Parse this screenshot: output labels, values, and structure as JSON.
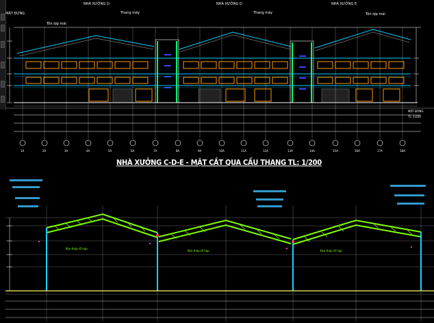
{
  "drawing": {
    "section_title": "NHÀ XƯỞNG C-D-E - MẶT CẮT QUA CẦU THANG   TL: 1/200",
    "elevation_tags": [
      "NHÀ XƯỞNG D",
      "NHÀ XƯỞNG D",
      "NHÀ XƯỞNG E"
    ],
    "top_left_tag": "MẶT ĐỨNG",
    "stair_labels": [
      "Thang máy",
      "Thang máy"
    ],
    "roof_labels": [
      "Tôn lợp mái",
      "Tôn lợp mái"
    ],
    "truss_labels": [
      "Kèo thép tổ hợp",
      "Kèo thép tổ hợp",
      "Kèo thép tổ hợp"
    ],
    "axis_labels": [
      "1A",
      "2A",
      "3A",
      "4A",
      "5A",
      "6A",
      "7A",
      "8A",
      "9A",
      "10A",
      "11A",
      "12A",
      "13A",
      "14A",
      "15A",
      "16A",
      "17A",
      "18A"
    ],
    "right_notes": [
      "MẶT ĐỨNG",
      "TL: 1/200"
    ]
  },
  "colors": {
    "background": "#000000",
    "roof_green": "#7fff00",
    "column_green": "#00ff66",
    "orange": "#ff9900",
    "cyan": "#00ccff",
    "yellow": "#ffff66",
    "white": "#ffffff"
  }
}
